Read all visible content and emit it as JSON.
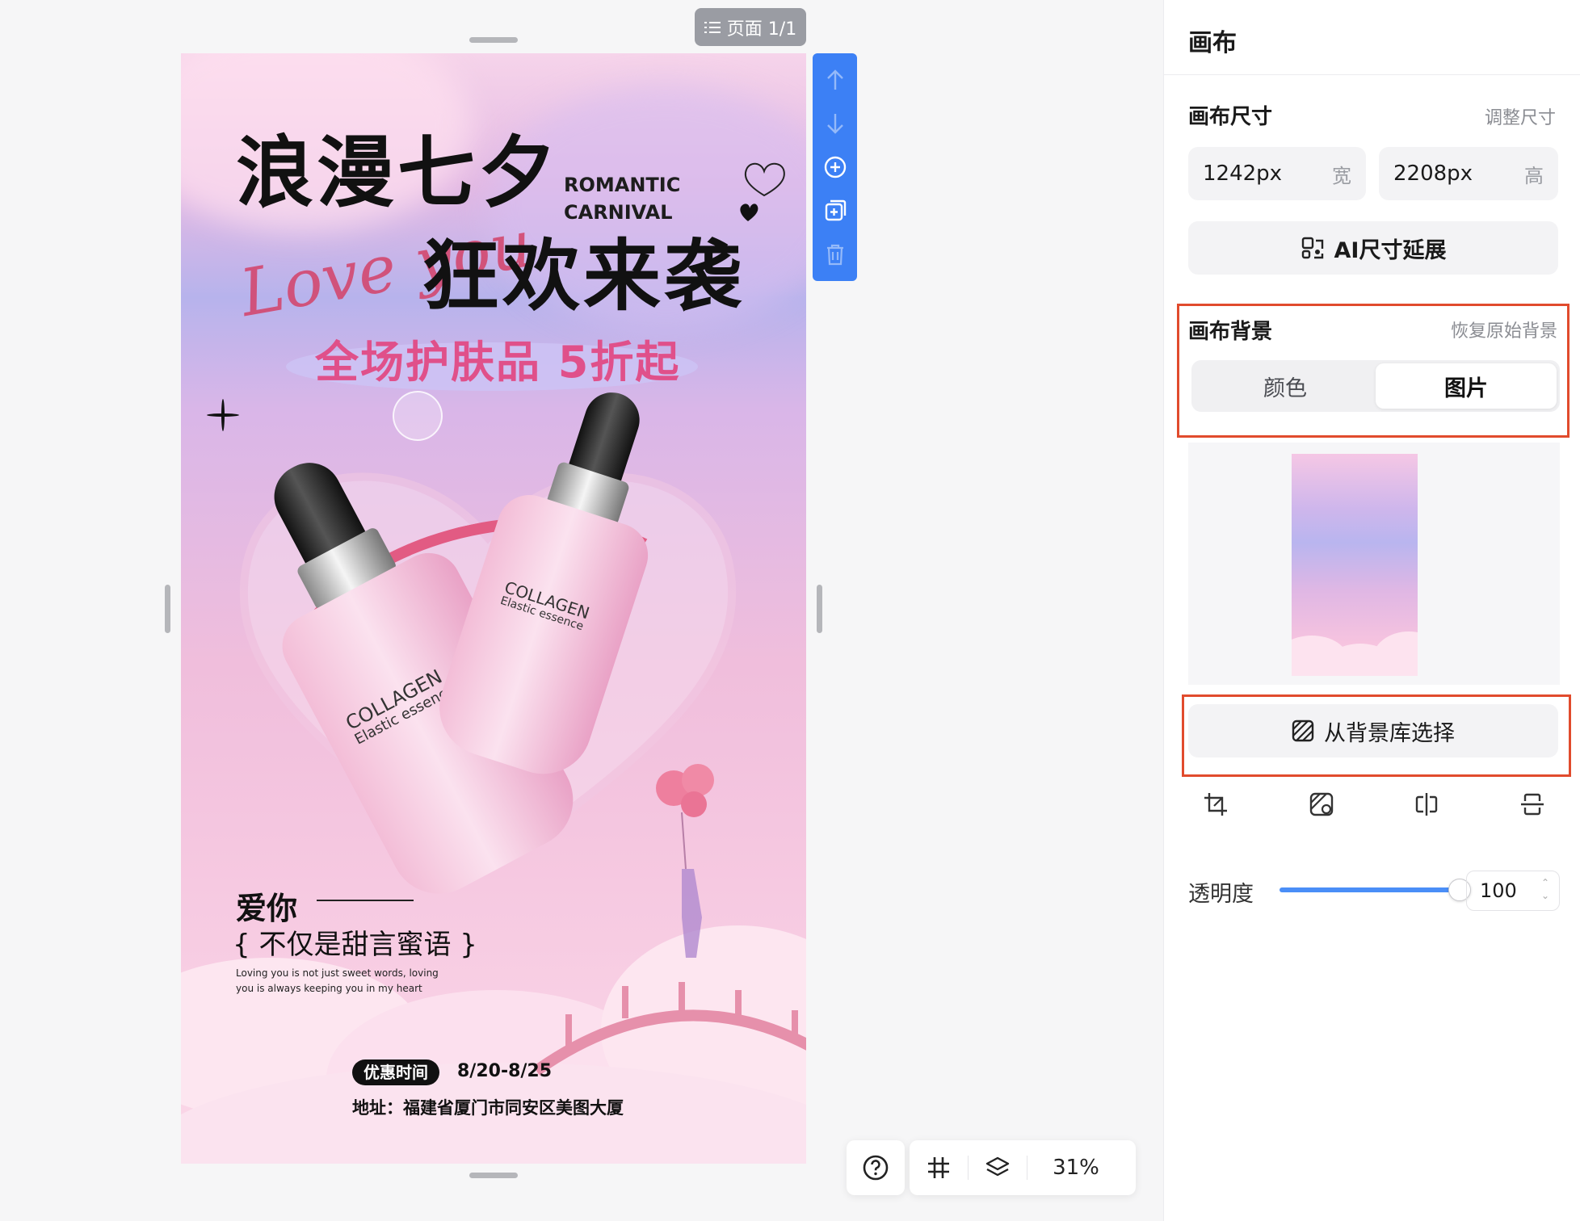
{
  "canvas": {
    "page_indicator": "页面 1/1",
    "zoom": "31%",
    "poster": {
      "title_line1": "浪漫七夕",
      "title_line2": "狂欢来袭",
      "english_tag_1": "ROMANTIC",
      "english_tag_2": "CARNIVAL",
      "script_text": "Love you",
      "sale_text": "全场护肤品 5折起",
      "bottle_brand": "COLLAGEN",
      "bottle_subtitle": "Elastic essence",
      "love_heading": "爱你",
      "quote": "{ 不仅是甜言蜜语 }",
      "english_paragraph": "Loving you is not just sweet words, loving you is always keeping you in my heart",
      "promo_label": "优惠时间",
      "promo_dates": "8/20-8/25",
      "address": "地址：福建省厦门市同安区美图大厦"
    }
  },
  "vertical_toolbar": [
    "arrow-up-icon",
    "arrow-down-icon",
    "add-circle-icon",
    "duplicate-icon",
    "trash-icon"
  ],
  "bottom_bar": [
    "help-icon",
    "grid-icon",
    "layers-icon"
  ],
  "panel": {
    "title": "画布",
    "size_section": {
      "title": "画布尺寸",
      "action": "调整尺寸",
      "width_value": "1242px",
      "width_unit": "宽",
      "height_value": "2208px",
      "height_unit": "高",
      "ai_button": "AI尺寸延展"
    },
    "background_section": {
      "title": "画布背景",
      "action": "恢复原始背景",
      "tabs": [
        "颜色",
        "图片"
      ],
      "active_tab": "图片",
      "library_button": "从背景库选择"
    },
    "image_tools": [
      "crop-icon",
      "replace-image-icon",
      "flip-horizontal-icon",
      "flip-vertical-icon"
    ],
    "opacity": {
      "label": "透明度",
      "value": "100",
      "level": 1.0
    }
  },
  "colors": {
    "accent": "#3c80f5",
    "highlight_box": "#e14b2d",
    "sale_pink": "#e0508a"
  }
}
